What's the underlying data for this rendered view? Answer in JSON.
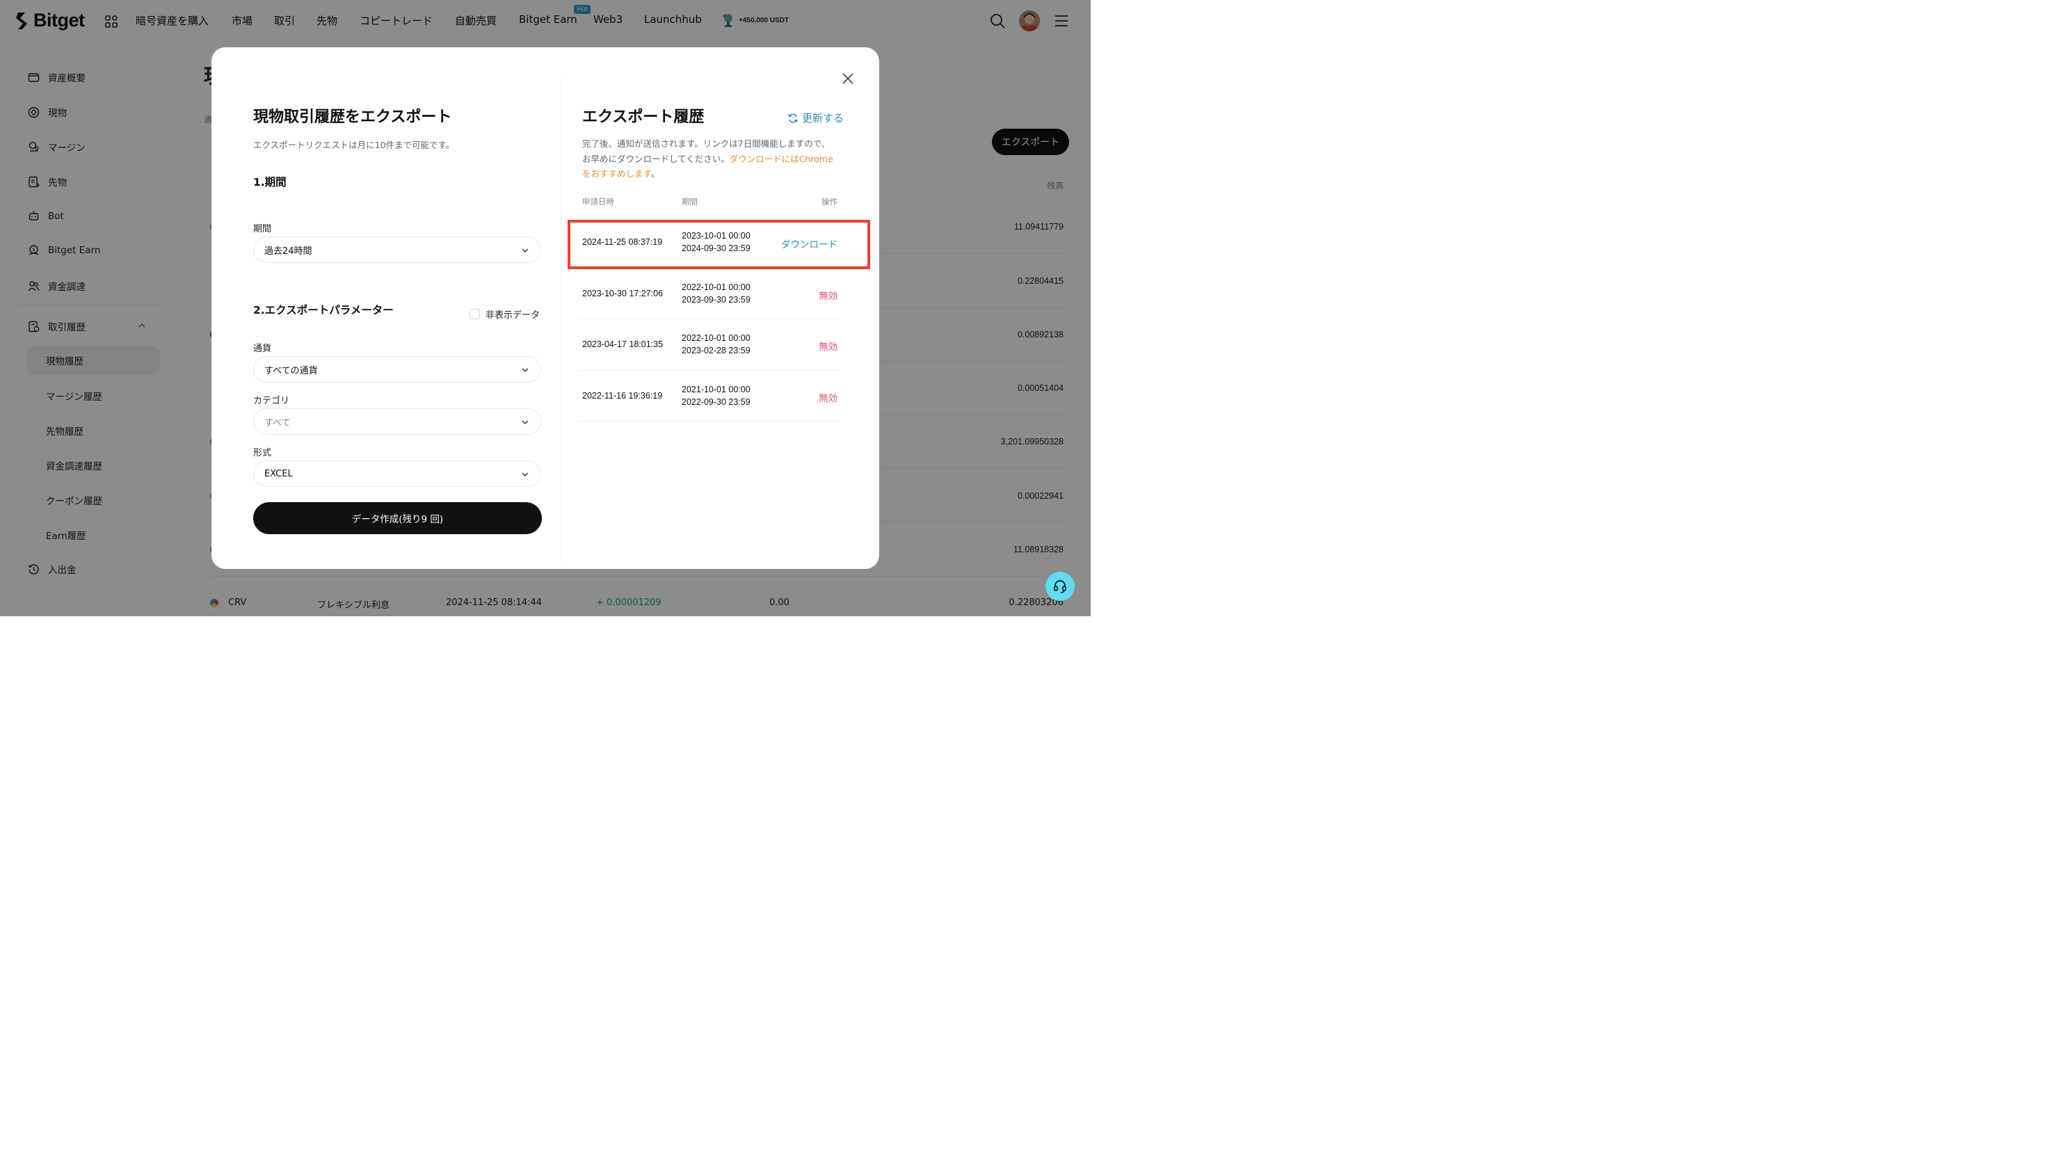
{
  "nav": {
    "logo": "Bitget",
    "items": [
      "暗号資産を購入",
      "市場",
      "取引",
      "先物",
      "コピートレード",
      "自動売買",
      "Bitget Earn",
      "Web3",
      "Launchhub"
    ],
    "hot_badge": "Hot",
    "promo": "+450,000 USDT"
  },
  "sidebar": {
    "items": [
      "資産概要",
      "現物",
      "マージン",
      "先物",
      "Bot",
      "Bitget Earn",
      "資金調達"
    ],
    "history_group": "取引履歴",
    "history_sub": [
      "現物履歴",
      "マージン履歴",
      "先物履歴",
      "資金調達履歴",
      "クーポン履歴",
      "Earn履歴"
    ],
    "deposit": "入出金"
  },
  "background": {
    "title_fragment": "現",
    "label1": "通",
    "export_button": "エクスポート",
    "balance_header": "残高",
    "balances": [
      "11.09411779",
      "0.22804415",
      "0.00892138",
      "0.00051404",
      "3,201.09950328",
      "0.00022941",
      "11.08918328"
    ],
    "last_row": {
      "coin": "CRV",
      "type": "フレキシブル利息",
      "time": "2024-11-25 08:14:44",
      "change": "+ 0.00001209",
      "fee": "0.00",
      "balance": "0.22803206"
    }
  },
  "modal": {
    "title": "現物取引履歴をエクスポート",
    "subtitle": "エクスポートリクエストは月に10件まで可能です。",
    "section1": "1.期間",
    "period_label": "期間",
    "period_value": "過去24時間",
    "section2": "2.エクスポートパラメーター",
    "hidden_data": "非表示データ",
    "currency_label": "通貨",
    "currency_value": "すべての通貨",
    "category_label": "カテゴリ",
    "category_placeholder": "すべて",
    "format_label": "形式",
    "format_value": "EXCEL",
    "create_button": "データ作成(残り9 回)",
    "history_title": "エクスポート履歴",
    "refresh": "更新する",
    "desc_normal": "完了後、通知が送信されます。リンクは7日間機能しますので、お早めにダウンロードしてください。",
    "desc_warn": "ダウンロードにはChromeをおすすめします",
    "desc_end": "。",
    "col_date": "申請日時",
    "col_period": "期間",
    "col_action": "操作",
    "rows": [
      {
        "date": "2024-11-25 08:37:19",
        "from": "2023-10-01 00:00",
        "to": "2024-09-30 23:59",
        "action": "ダウンロード"
      },
      {
        "date": "2023-10-30 17:27:06",
        "from": "2022-10-01 00:00",
        "to": "2023-09-30 23:59",
        "action": "無効"
      },
      {
        "date": "2023-04-17 18:01:35",
        "from": "2022-10-01 00:00",
        "to": "2023-02-28 23:59",
        "action": "無効"
      },
      {
        "date": "2022-11-16 19:36:19",
        "from": "2021-10-01 00:00",
        "to": "2022-09-30 23:59",
        "action": "無効"
      }
    ]
  },
  "colors": {
    "accent_link": "#2a8fc0",
    "invalid": "#e0506a",
    "warning": "#ef8a2f",
    "highlight": "#e8442c",
    "primary": "#111111"
  }
}
